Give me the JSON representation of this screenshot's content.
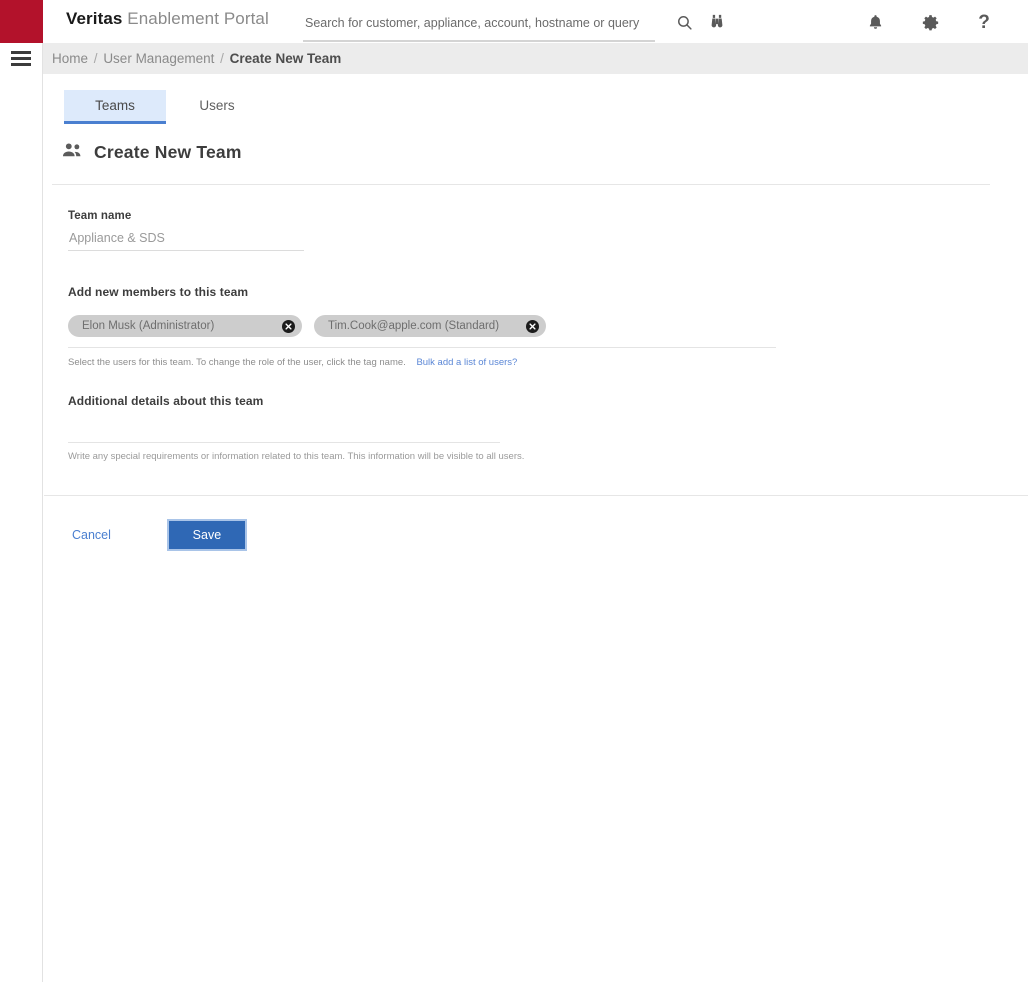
{
  "app": {
    "brand_bold": "Veritas",
    "brand_rest": " Enablement Portal",
    "accent_red": "#b3122b",
    "accent_blue": "#2f68b5",
    "link_blue": "#4a7fd0"
  },
  "header": {
    "menu_icon": "hamburger-icon",
    "search": {
      "placeholder": "Search for customer, appliance, account, hostname or query",
      "value": ""
    },
    "icons": [
      {
        "name": "search-icon",
        "glyph": "magnifier"
      },
      {
        "name": "binoculars-icon",
        "glyph": "binoculars"
      },
      {
        "name": "notifications-icon",
        "glyph": "bell"
      },
      {
        "name": "settings-icon",
        "glyph": "gear"
      },
      {
        "name": "help-icon",
        "glyph": "?"
      },
      {
        "name": "user-avatar",
        "glyph": "circle"
      }
    ],
    "help_glyph": "?"
  },
  "breadcrumb": {
    "home": "Home",
    "sep1": "/",
    "section": "User Management",
    "sep2": "/",
    "current": "Create New Team"
  },
  "tabs": [
    {
      "label": "Teams",
      "active": true
    },
    {
      "label": "Users",
      "active": false
    }
  ],
  "page": {
    "icon": "people-group-icon",
    "title": "Create New Team"
  },
  "form": {
    "team_name": {
      "label": "Team name",
      "placeholder": "Appliance & SDS",
      "value": ""
    },
    "members": {
      "label": "Add new members to this team",
      "chips": [
        {
          "label": "Elon Musk (Administrator)",
          "remove_icon": "close-circle-icon"
        },
        {
          "label": "Tim.Cook@apple.com (Standard)",
          "remove_icon": "close-circle-icon"
        }
      ],
      "helper": "Select the users for this team. To change the role of the user, click the tag name.",
      "helper_link": "Bulk add a list of users?"
    },
    "details": {
      "label": "Additional details about this team",
      "placeholder": "",
      "value": "",
      "helper": "Write any special requirements or information related to this team. This information will be visible to all users."
    }
  },
  "actions": {
    "cancel_label": "Cancel",
    "save_label": "Save"
  }
}
